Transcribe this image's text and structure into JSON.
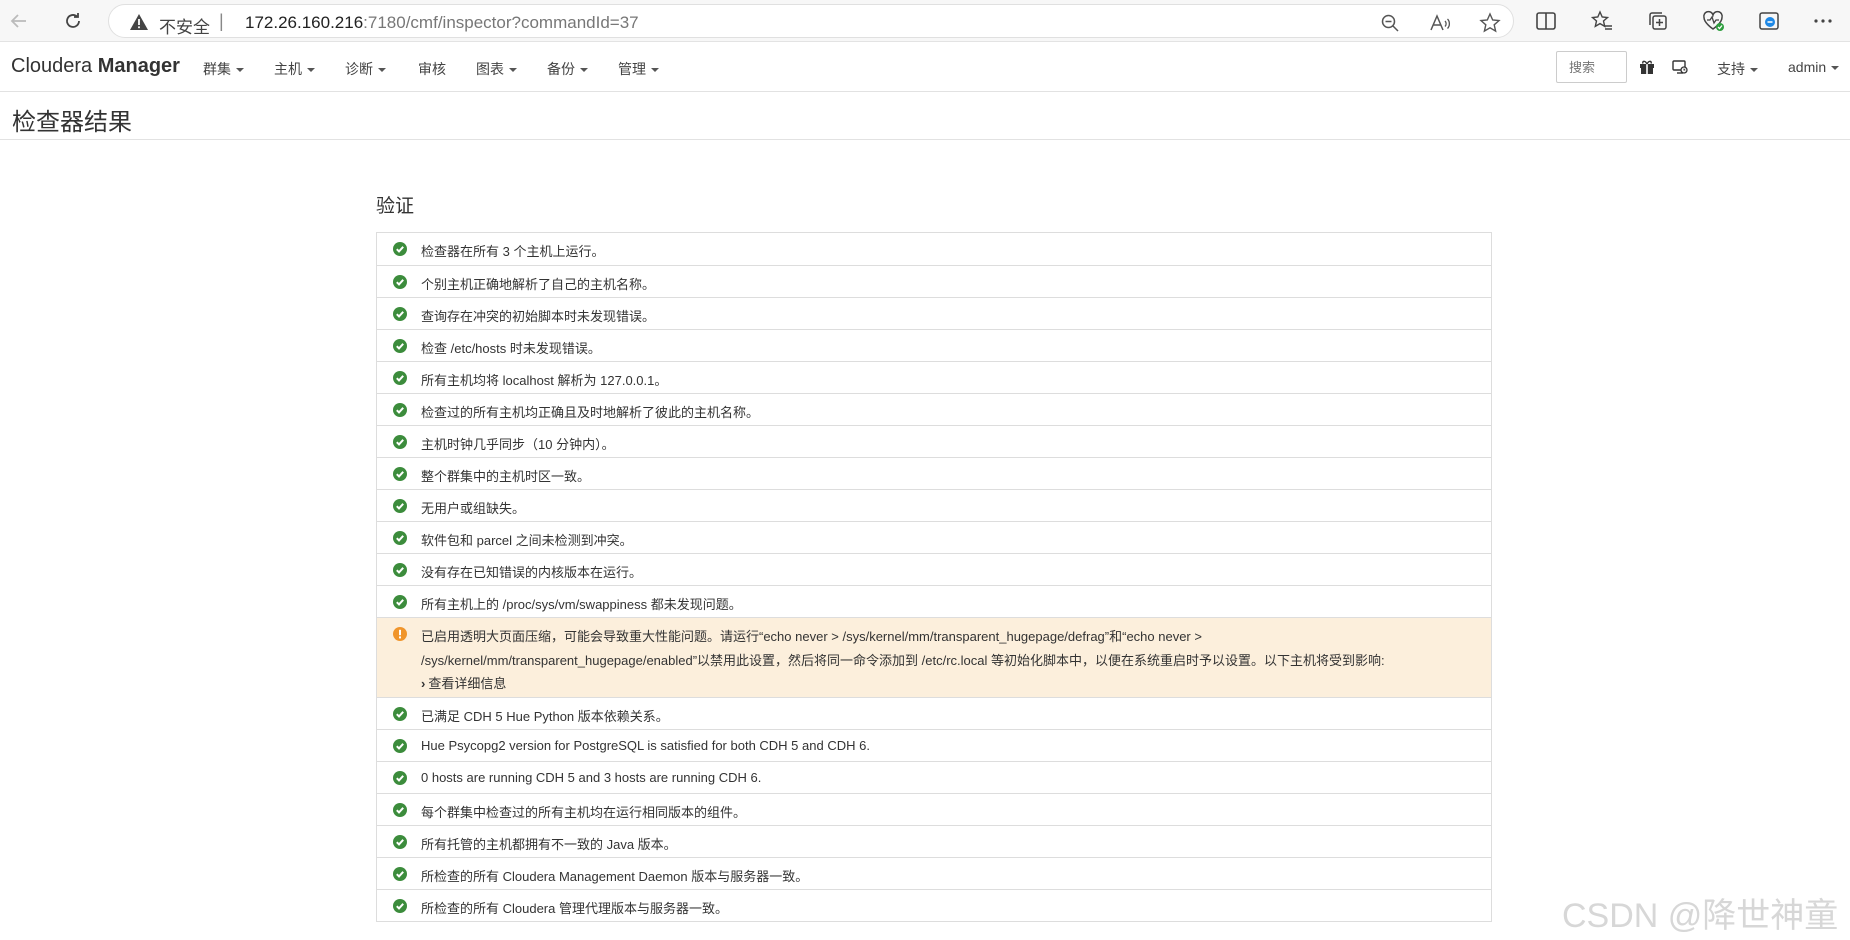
{
  "browser": {
    "security_label": "不安全",
    "separator": "|",
    "url_host": "172.26.160.216",
    "url_path": ":7180/cmf/inspector?commandId=37"
  },
  "header": {
    "brand_light": "Cloudera ",
    "brand_bold": "Manager",
    "menus": [
      "群集",
      "主机",
      "诊断",
      "审核",
      "图表",
      "备份",
      "管理"
    ],
    "search_placeholder": "搜索",
    "support": "支持",
    "user": "admin"
  },
  "page": {
    "title": "检查器结果",
    "section_title": "验证"
  },
  "checks_before_warning": [
    "检查器在所有 3 个主机上运行。",
    "个别主机正确地解析了自己的主机名称。",
    "查询存在冲突的初始脚本时未发现错误。",
    "检查 /etc/hosts 时未发现错误。",
    "所有主机均将 localhost 解析为 127.0.0.1。",
    "检查过的所有主机均正确且及时地解析了彼此的主机名称。",
    "主机时钟几乎同步（10 分钟内）。",
    "整个群集中的主机时区一致。",
    "无用户或组缺失。",
    "软件包和 parcel 之间未检测到冲突。",
    "没有存在已知错误的内核版本在运行。",
    "所有主机上的 /proc/sys/vm/swappiness 都未发现问题。"
  ],
  "warning": {
    "line1": "已启用透明大页面压缩，可能会导致重大性能问题。请运行“echo never > /sys/kernel/mm/transparent_hugepage/defrag”和“echo never >",
    "line2": "/sys/kernel/mm/transparent_hugepage/enabled”以禁用此设置，然后将同一命令添加到 /etc/rc.local 等初始化脚本中，以便在系统重启时予以设置。以下主机将受到影响:",
    "detail_label": "查看详细信息"
  },
  "checks_after_warning": [
    "已满足 CDH 5 Hue Python 版本依赖关系。",
    "Hue Psycopg2 version for PostgreSQL is satisfied for both CDH 5 and CDH 6.",
    "0 hosts are running CDH 5 and 3 hosts are running CDH 6.",
    "每个群集中检查过的所有主机均在运行相同版本的组件。",
    "所有托管的主机都拥有不一致的 Java 版本。",
    "所检查的所有 Cloudera Management Daemon 版本与服务器一致。",
    "所检查的所有 Cloudera 管理代理版本与服务器一致。"
  ],
  "watermark": "CSDN @降世神童",
  "colors": {
    "ok": "#3c8c3c",
    "warn": "#f0952b",
    "warn_bg": "#fcefdc"
  }
}
